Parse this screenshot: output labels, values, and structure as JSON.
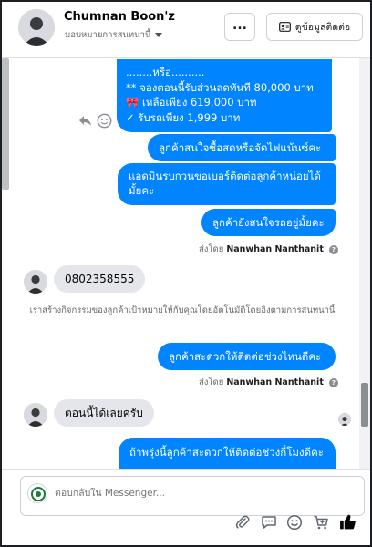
{
  "header": {
    "contact_name": "Chumnan Boon'z",
    "assignee_label": "มอบหมายการสนทนานี้",
    "more_label": "...",
    "contact_info_label": "ดูข้อมูลติดต่อ"
  },
  "messages": {
    "m1_lines": [
      "........หรือ..........",
      "** จองตอนนี้รับส่วนลดทันที 80,000 บาท",
      "🎀  เหลือเพียง 619,000 บาท",
      "✓ รับรถเพียง 1,999 บาท"
    ],
    "m2": "ลูกค้าสนใจซื้อสดหรือจัดไฟแน้นซ์คะ",
    "m3": "แอดมินรบกวนขอเบอร์ติดต่อลูกค้าหน่อยได้มั้ยคะ",
    "m4": "ลูกค้ายังสนใจรถอยู่มั้ยคะ",
    "sent_by_prefix_1": "ส่งโดย",
    "sent_by_name_1": "Nanwhan Nanthanit",
    "incoming_phone": "0802358555",
    "system_note": "เราสร้างกิจกรรมของลูกค้าเป้าหมายให้กับคุณโดยอัตโนมัติโดยอิงตามการสนทนานี้",
    "m5": "ลูกค้าสะดวกให้ติดต่อช่วงไหนดีคะ",
    "sent_by_prefix_2": "ส่งโดย",
    "sent_by_name_2": "Nanwhan Nanthanit",
    "incoming_reply": "ตอนนี้ได้เลยครับ",
    "m6": "ถ้าพรุ่งนี้ลูกค้าสะดวกให้ติดต่อช่วงกี่โมงดีคะ"
  },
  "composer": {
    "placeholder": "ตอบกลับใน Messenger..."
  },
  "icons": {
    "more": "ellipsis-icon",
    "contact": "contact-card-icon",
    "reply": "reply-icon",
    "react": "smiley-icon",
    "attach": "paperclip-icon",
    "saved_replies": "chat-bubble-icon",
    "emoji": "emoji-icon",
    "cart": "cart-icon",
    "like": "thumbs-up-icon"
  },
  "colors": {
    "outgoing_bubble": "#0084ff",
    "incoming_bubble": "#e4e6eb",
    "like_button": "#050505"
  }
}
